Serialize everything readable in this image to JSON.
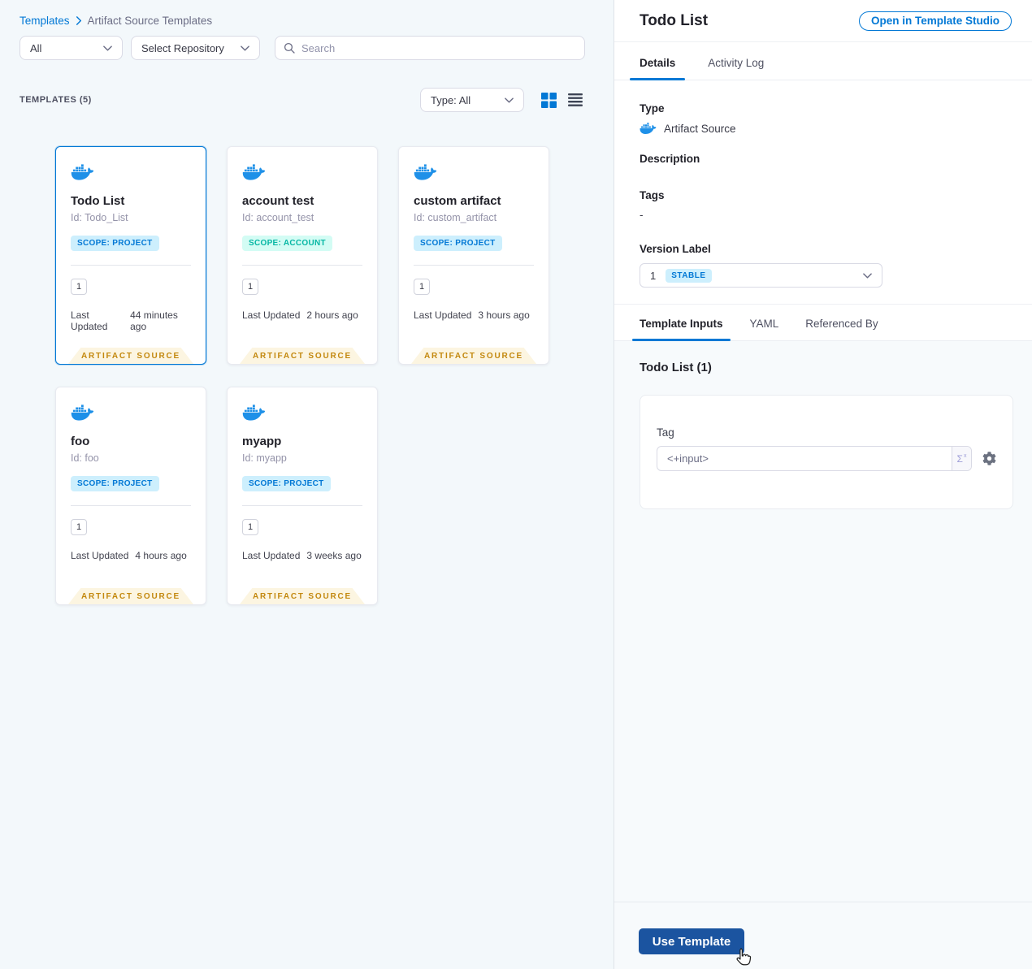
{
  "colors": {
    "accent_blue": "#0278d5",
    "docker_blue": "#1e90e8",
    "use_template_button": "#1b54a0",
    "ribbon_bg": "#fcf5e1",
    "ribbon_text": "#c3880e",
    "scope_project_bg": "#cdeffd",
    "scope_account_bg": "#d3fcf4",
    "left_panel_bg": "#f3f8fb",
    "section_bg": "#f7fafc"
  },
  "left_panel": {
    "breadcrumb": {
      "link": "Templates",
      "current": "Artifact Source Templates"
    },
    "filters": {
      "scope_dropdown": "All",
      "repository_dropdown": "Select Repository",
      "search_placeholder": "Search"
    },
    "list_header": {
      "count_label": "TEMPLATES (5)",
      "type_dropdown": "Type: All"
    },
    "cards": [
      {
        "title": "Todo List",
        "id": "Id: Todo_List",
        "scope": "SCOPE: PROJECT",
        "version": "1",
        "last_updated_label": "Last Updated",
        "last_updated": "44 minutes ago",
        "ribbon": "ARTIFACT SOURCE"
      },
      {
        "title": "account test",
        "id": "Id: account_test",
        "scope": "SCOPE: ACCOUNT",
        "version": "1",
        "last_updated_label": "Last Updated",
        "last_updated": "2 hours ago",
        "ribbon": "ARTIFACT SOURCE"
      },
      {
        "title": "custom artifact",
        "id": "Id: custom_artifact",
        "scope": "SCOPE: PROJECT",
        "version": "1",
        "last_updated_label": "Last Updated",
        "last_updated": "3 hours ago",
        "ribbon": "ARTIFACT SOURCE"
      },
      {
        "title": "foo",
        "id": "Id: foo",
        "scope": "SCOPE: PROJECT",
        "version": "1",
        "last_updated_label": "Last Updated",
        "last_updated": "4 hours ago",
        "ribbon": "ARTIFACT SOURCE"
      },
      {
        "title": "myapp",
        "id": "Id: myapp",
        "scope": "SCOPE: PROJECT",
        "version": "1",
        "last_updated_label": "Last Updated",
        "last_updated": "3 weeks ago",
        "ribbon": "ARTIFACT SOURCE"
      }
    ]
  },
  "right_panel": {
    "title": "Todo List",
    "open_button": "Open in Template Studio",
    "tabs": [
      "Details",
      "Activity Log"
    ],
    "details": {
      "type_label": "Type",
      "type_value": "Artifact Source",
      "description_label": "Description",
      "tags_label": "Tags",
      "tags_value": "-",
      "version_label": "Version Label",
      "version_value": "1",
      "version_badge": "STABLE"
    },
    "inner_tabs": [
      "Template Inputs",
      "YAML",
      "Referenced By"
    ],
    "inputs_section": {
      "heading": "Todo List (1)",
      "tag_label": "Tag",
      "tag_value": "<+input>",
      "sigma": "Σ"
    },
    "use_template_button": "Use Template"
  }
}
